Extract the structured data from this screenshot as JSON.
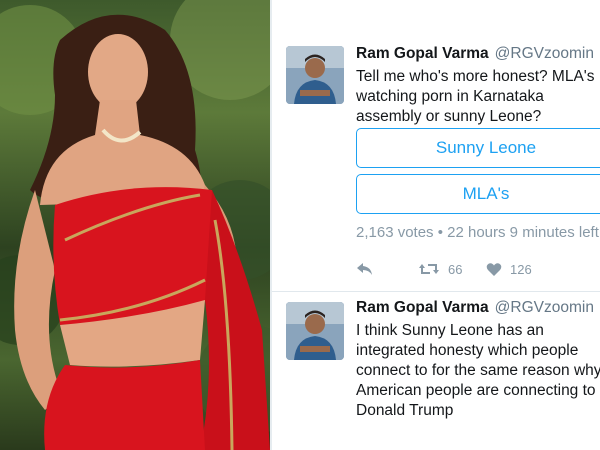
{
  "photo": {
    "icon": "portrait-photo"
  },
  "tweets": [
    {
      "display_name": "Ram Gopal Varma",
      "handle": "@RGVzoomin",
      "text": "Tell me who's more honest? MLA's watching porn in Karnataka assembly or sunny Leone?",
      "poll": {
        "options": [
          "Sunny Leone",
          "MLA's"
        ],
        "meta": "2,163 votes • 22 hours 9 minutes left"
      },
      "actions": {
        "retweets": "66",
        "likes": "126"
      }
    },
    {
      "display_name": "Ram Gopal Varma",
      "handle": "@RGVzoomin",
      "text": "I think Sunny Leone has an integrated honesty which people connect to for the same reason why American people are connecting to Donald Trump"
    }
  ],
  "colors": {
    "accent": "#1da1f2",
    "muted": "#8899a6",
    "text": "#14171a",
    "saree": "#d8141e"
  }
}
